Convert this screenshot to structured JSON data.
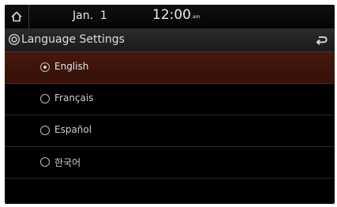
{
  "status_bar": {
    "home_icon": "home-icon",
    "date": "Jan.  1",
    "time": "12:00",
    "ampm": "am"
  },
  "title_bar": {
    "settings_icon": "settings-icon",
    "title": "Language Settings",
    "back_icon": "back-arrow-icon"
  },
  "languages": {
    "selected": "English",
    "options": [
      {
        "label": "English"
      },
      {
        "label": "Français"
      },
      {
        "label": "Español"
      },
      {
        "label": "한국어"
      }
    ]
  },
  "colors": {
    "selected_row": "#3d130b",
    "background": "#000000"
  }
}
